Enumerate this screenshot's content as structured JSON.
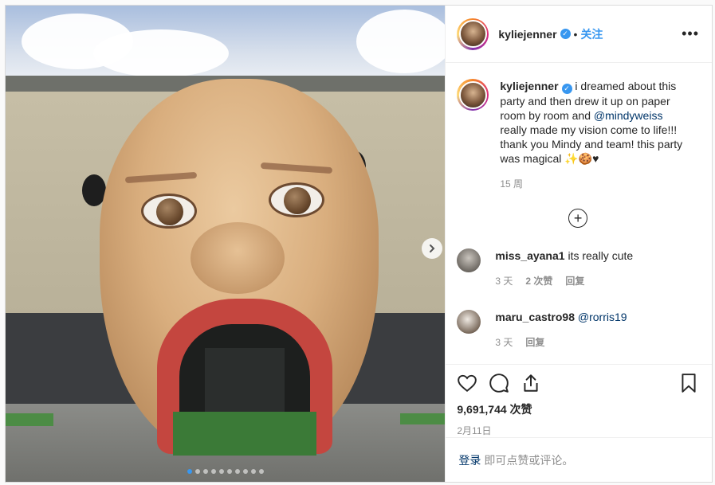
{
  "post": {
    "username": "kyliejenner",
    "follow_label": "关注",
    "bullet": "•",
    "more_label": "•••",
    "caption_parts": {
      "before": "i dreamed about this party and then drew it up on paper room by room and ",
      "mention": "@mindyweiss",
      "after": " really made my vision come to life!!! thank you Mindy and team! this party was magical ✨🍪♥"
    },
    "caption_time": "15 周",
    "load_more": "+",
    "likes": "9,691,744 次赞",
    "date": "2月11日",
    "carousel": {
      "dots": 10,
      "active_index": 0,
      "next_icon": "chevron-right-icon"
    }
  },
  "comments": [
    {
      "username": "miss_ayana1",
      "text": "its really cute",
      "mention": "",
      "time": "3 天",
      "likes": "2 次赞",
      "reply": "回复"
    },
    {
      "username": "maru_castro98",
      "text": "",
      "mention": "@rorris19",
      "time": "3 天",
      "likes": "",
      "reply": "回复"
    }
  ],
  "add_comment": {
    "login": "登录",
    "rest": "即可点赞或评论。"
  },
  "colors": {
    "accent": "#3897f0",
    "link": "#003569",
    "muted": "#8e8e8e"
  }
}
